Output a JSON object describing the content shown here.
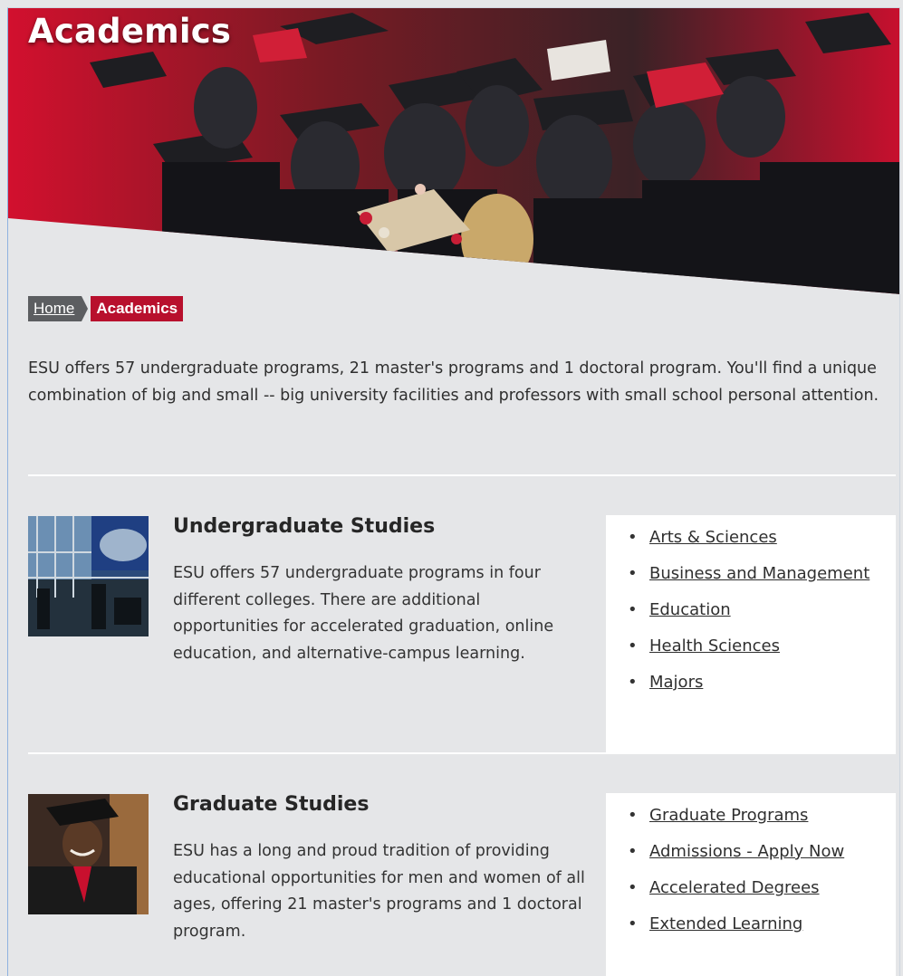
{
  "hero": {
    "title": "Academics"
  },
  "breadcrumb": {
    "home": "Home",
    "current": "Academics"
  },
  "intro": "ESU offers 57 undergraduate programs, 21 master's programs and 1 doctoral program. You'll find a unique combination of big and small -- big university facilities and professors with small school personal attention.",
  "sections": [
    {
      "title": "Undergraduate Studies",
      "description": "ESU offers 57 undergraduate programs in four different colleges. There are additional opportunities for accelerated graduation, online education, and alternative-campus learning.",
      "links": [
        "Arts & Sciences",
        "Business and Management",
        "Education",
        "Health Sciences",
        "Majors"
      ]
    },
    {
      "title": "Graduate Studies",
      "description": "ESU has a long and proud tradition of providing educational opportunities for men and women of all ages, offering 21 master's programs and 1 doctoral program.",
      "links": [
        "Graduate Programs",
        "Admissions - Apply Now",
        "Accelerated Degrees",
        "Extended Learning"
      ]
    }
  ],
  "colors": {
    "brand_red": "#b8102d",
    "breadcrumb_gray": "#5c5e61",
    "background": "#e5e6e8"
  }
}
